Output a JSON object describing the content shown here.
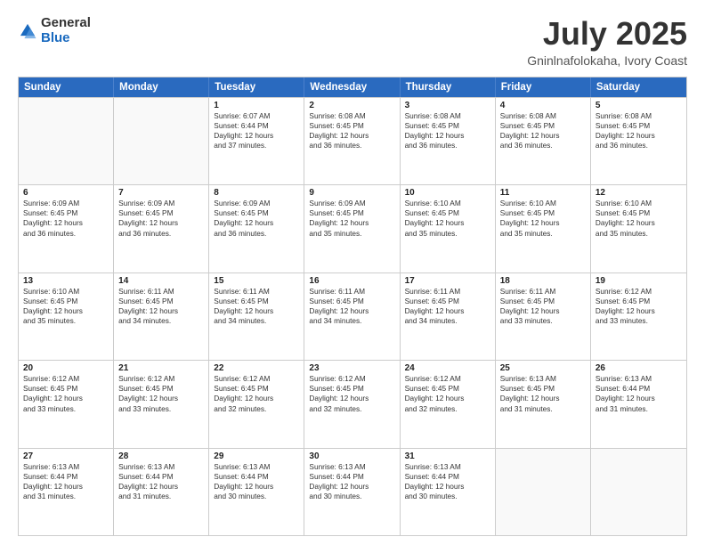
{
  "logo": {
    "general": "General",
    "blue": "Blue"
  },
  "title": "July 2025",
  "subtitle": "Gninlnafolokaha, Ivory Coast",
  "days_of_week": [
    "Sunday",
    "Monday",
    "Tuesday",
    "Wednesday",
    "Thursday",
    "Friday",
    "Saturday"
  ],
  "weeks": [
    [
      {
        "day": "",
        "info": ""
      },
      {
        "day": "",
        "info": ""
      },
      {
        "day": "1",
        "sunrise": "6:07 AM",
        "sunset": "6:44 PM",
        "daylight": "12 hours and 37 minutes."
      },
      {
        "day": "2",
        "sunrise": "6:08 AM",
        "sunset": "6:45 PM",
        "daylight": "12 hours and 36 minutes."
      },
      {
        "day": "3",
        "sunrise": "6:08 AM",
        "sunset": "6:45 PM",
        "daylight": "12 hours and 36 minutes."
      },
      {
        "day": "4",
        "sunrise": "6:08 AM",
        "sunset": "6:45 PM",
        "daylight": "12 hours and 36 minutes."
      },
      {
        "day": "5",
        "sunrise": "6:08 AM",
        "sunset": "6:45 PM",
        "daylight": "12 hours and 36 minutes."
      }
    ],
    [
      {
        "day": "6",
        "sunrise": "6:09 AM",
        "sunset": "6:45 PM",
        "daylight": "12 hours and 36 minutes."
      },
      {
        "day": "7",
        "sunrise": "6:09 AM",
        "sunset": "6:45 PM",
        "daylight": "12 hours and 36 minutes."
      },
      {
        "day": "8",
        "sunrise": "6:09 AM",
        "sunset": "6:45 PM",
        "daylight": "12 hours and 36 minutes."
      },
      {
        "day": "9",
        "sunrise": "6:09 AM",
        "sunset": "6:45 PM",
        "daylight": "12 hours and 35 minutes."
      },
      {
        "day": "10",
        "sunrise": "6:10 AM",
        "sunset": "6:45 PM",
        "daylight": "12 hours and 35 minutes."
      },
      {
        "day": "11",
        "sunrise": "6:10 AM",
        "sunset": "6:45 PM",
        "daylight": "12 hours and 35 minutes."
      },
      {
        "day": "12",
        "sunrise": "6:10 AM",
        "sunset": "6:45 PM",
        "daylight": "12 hours and 35 minutes."
      }
    ],
    [
      {
        "day": "13",
        "sunrise": "6:10 AM",
        "sunset": "6:45 PM",
        "daylight": "12 hours and 35 minutes."
      },
      {
        "day": "14",
        "sunrise": "6:11 AM",
        "sunset": "6:45 PM",
        "daylight": "12 hours and 34 minutes."
      },
      {
        "day": "15",
        "sunrise": "6:11 AM",
        "sunset": "6:45 PM",
        "daylight": "12 hours and 34 minutes."
      },
      {
        "day": "16",
        "sunrise": "6:11 AM",
        "sunset": "6:45 PM",
        "daylight": "12 hours and 34 minutes."
      },
      {
        "day": "17",
        "sunrise": "6:11 AM",
        "sunset": "6:45 PM",
        "daylight": "12 hours and 34 minutes."
      },
      {
        "day": "18",
        "sunrise": "6:11 AM",
        "sunset": "6:45 PM",
        "daylight": "12 hours and 33 minutes."
      },
      {
        "day": "19",
        "sunrise": "6:12 AM",
        "sunset": "6:45 PM",
        "daylight": "12 hours and 33 minutes."
      }
    ],
    [
      {
        "day": "20",
        "sunrise": "6:12 AM",
        "sunset": "6:45 PM",
        "daylight": "12 hours and 33 minutes."
      },
      {
        "day": "21",
        "sunrise": "6:12 AM",
        "sunset": "6:45 PM",
        "daylight": "12 hours and 33 minutes."
      },
      {
        "day": "22",
        "sunrise": "6:12 AM",
        "sunset": "6:45 PM",
        "daylight": "12 hours and 32 minutes."
      },
      {
        "day": "23",
        "sunrise": "6:12 AM",
        "sunset": "6:45 PM",
        "daylight": "12 hours and 32 minutes."
      },
      {
        "day": "24",
        "sunrise": "6:12 AM",
        "sunset": "6:45 PM",
        "daylight": "12 hours and 32 minutes."
      },
      {
        "day": "25",
        "sunrise": "6:13 AM",
        "sunset": "6:45 PM",
        "daylight": "12 hours and 31 minutes."
      },
      {
        "day": "26",
        "sunrise": "6:13 AM",
        "sunset": "6:44 PM",
        "daylight": "12 hours and 31 minutes."
      }
    ],
    [
      {
        "day": "27",
        "sunrise": "6:13 AM",
        "sunset": "6:44 PM",
        "daylight": "12 hours and 31 minutes."
      },
      {
        "day": "28",
        "sunrise": "6:13 AM",
        "sunset": "6:44 PM",
        "daylight": "12 hours and 31 minutes."
      },
      {
        "day": "29",
        "sunrise": "6:13 AM",
        "sunset": "6:44 PM",
        "daylight": "12 hours and 30 minutes."
      },
      {
        "day": "30",
        "sunrise": "6:13 AM",
        "sunset": "6:44 PM",
        "daylight": "12 hours and 30 minutes."
      },
      {
        "day": "31",
        "sunrise": "6:13 AM",
        "sunset": "6:44 PM",
        "daylight": "12 hours and 30 minutes."
      },
      {
        "day": "",
        "info": ""
      },
      {
        "day": "",
        "info": ""
      }
    ]
  ]
}
